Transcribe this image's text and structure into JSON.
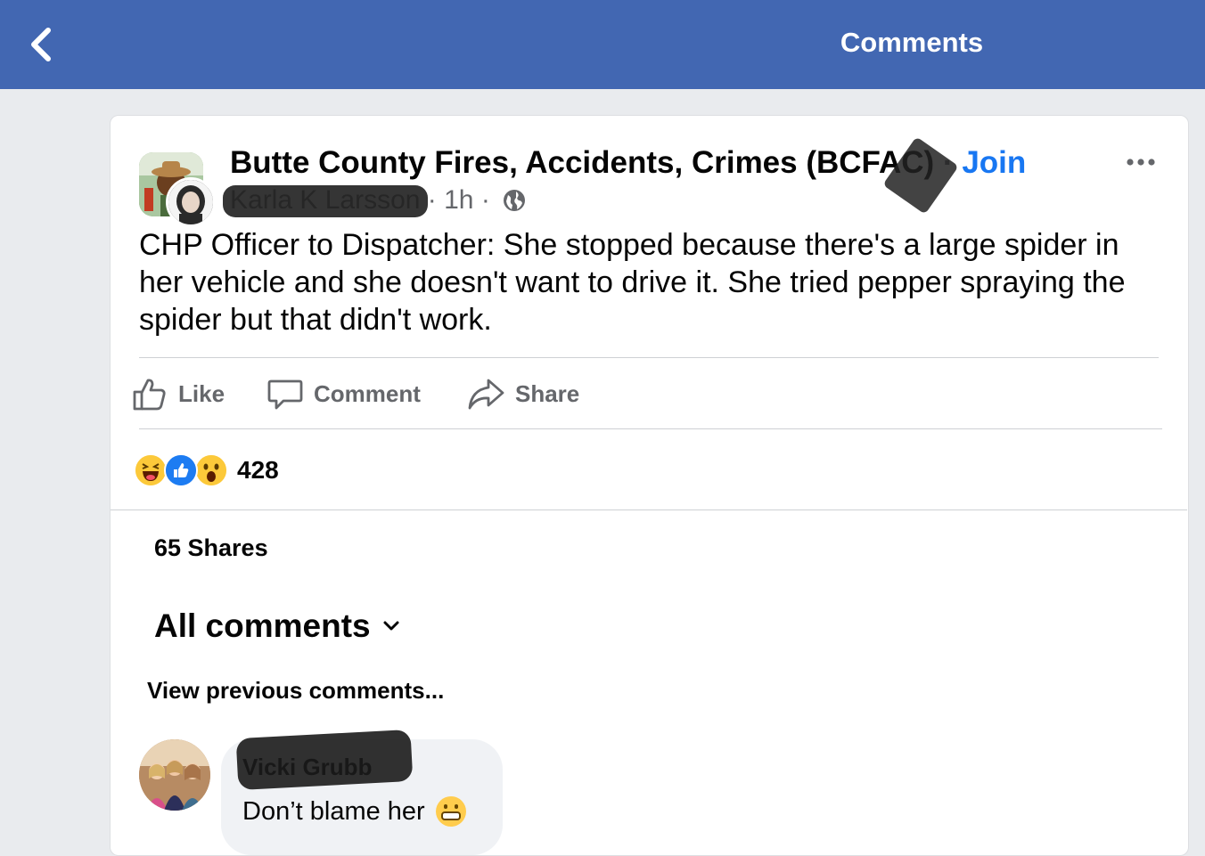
{
  "nav": {
    "title": "Comments",
    "back_icon": "chevron-left-icon"
  },
  "post": {
    "group_name": "Butte County Fires, Accidents, Crimes (BCFAC)",
    "separator": " · ",
    "join_label": "Join",
    "author": "Karla K Larsson",
    "time": "1h",
    "audience_icon": "globe-icon",
    "text": "CHP Officer to Dispatcher: She stopped because there's a large spider in her vehicle and she doesn't want to drive it. She tried pepper spraying the spider but that didn't work.",
    "more_icon": "more-icon"
  },
  "actions": {
    "like_label": "Like",
    "comment_label": "Comment",
    "share_label": "Share"
  },
  "reactions": {
    "icons": [
      "haha-icon",
      "like-icon",
      "wow-icon"
    ],
    "count": "428"
  },
  "shares_label": "65 Shares",
  "comments": {
    "filter_label": "All comments",
    "view_previous": "View previous comments...",
    "items": [
      {
        "author": "Vicki Grubb",
        "text": "Don’t blame her",
        "emoji": "grimacing-face-emoji"
      }
    ]
  },
  "colors": {
    "nav_bg": "#4267b2",
    "link": "#1877f2",
    "secondary_text": "#65676b"
  }
}
